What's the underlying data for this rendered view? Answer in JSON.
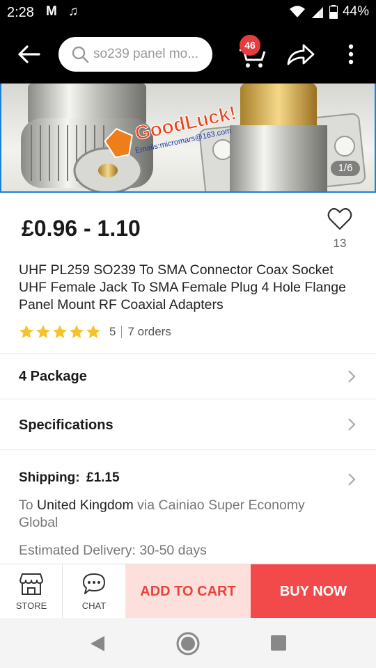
{
  "status_bar": {
    "time": "2:28",
    "notif_mail": "M",
    "notif_music": "♫",
    "battery": "44%"
  },
  "header": {
    "search_placeholder": "so239 panel mo...",
    "cart_count": "46"
  },
  "gallery": {
    "counter": "1/6",
    "watermark_text": "GoodLuck!",
    "watermark_email": "Emails:micromars@163.com"
  },
  "product": {
    "price": "£0.96 - 1.10",
    "wishlist_count": "13",
    "title": "UHF PL259 SO239 To SMA Connector Coax Socket UHF Female Jack To SMA Female Plug 4 Hole Flange Panel Mount RF Coaxial Adapters",
    "rating": "5",
    "stars": 5,
    "orders": "7 orders"
  },
  "rows": {
    "package": "4 Package",
    "specifications": "Specifications"
  },
  "shipping": {
    "label": "Shipping:",
    "price": "£1.15",
    "to_prefix": "To ",
    "destination": "United Kingdom",
    "via": " via Cainiao Super Economy Global",
    "delivery": "Estimated Delivery: 30-50 days"
  },
  "actions": {
    "store": "STORE",
    "chat": "CHAT",
    "add_to_cart": "ADD TO CART",
    "buy_now": "BUY NOW"
  },
  "colors": {
    "accent_red": "#f2494b",
    "badge_red": "#e73c3c",
    "star_yellow": "#f6c22a",
    "add_cart_bg": "#fde0dc"
  },
  "icons": [
    "back-arrow-icon",
    "search-icon",
    "cart-icon",
    "share-icon",
    "more-vert-icon",
    "heart-icon",
    "star-icon",
    "chevron-right-icon",
    "store-icon",
    "chat-icon",
    "nav-back-icon",
    "nav-home-icon",
    "nav-recent-icon"
  ]
}
